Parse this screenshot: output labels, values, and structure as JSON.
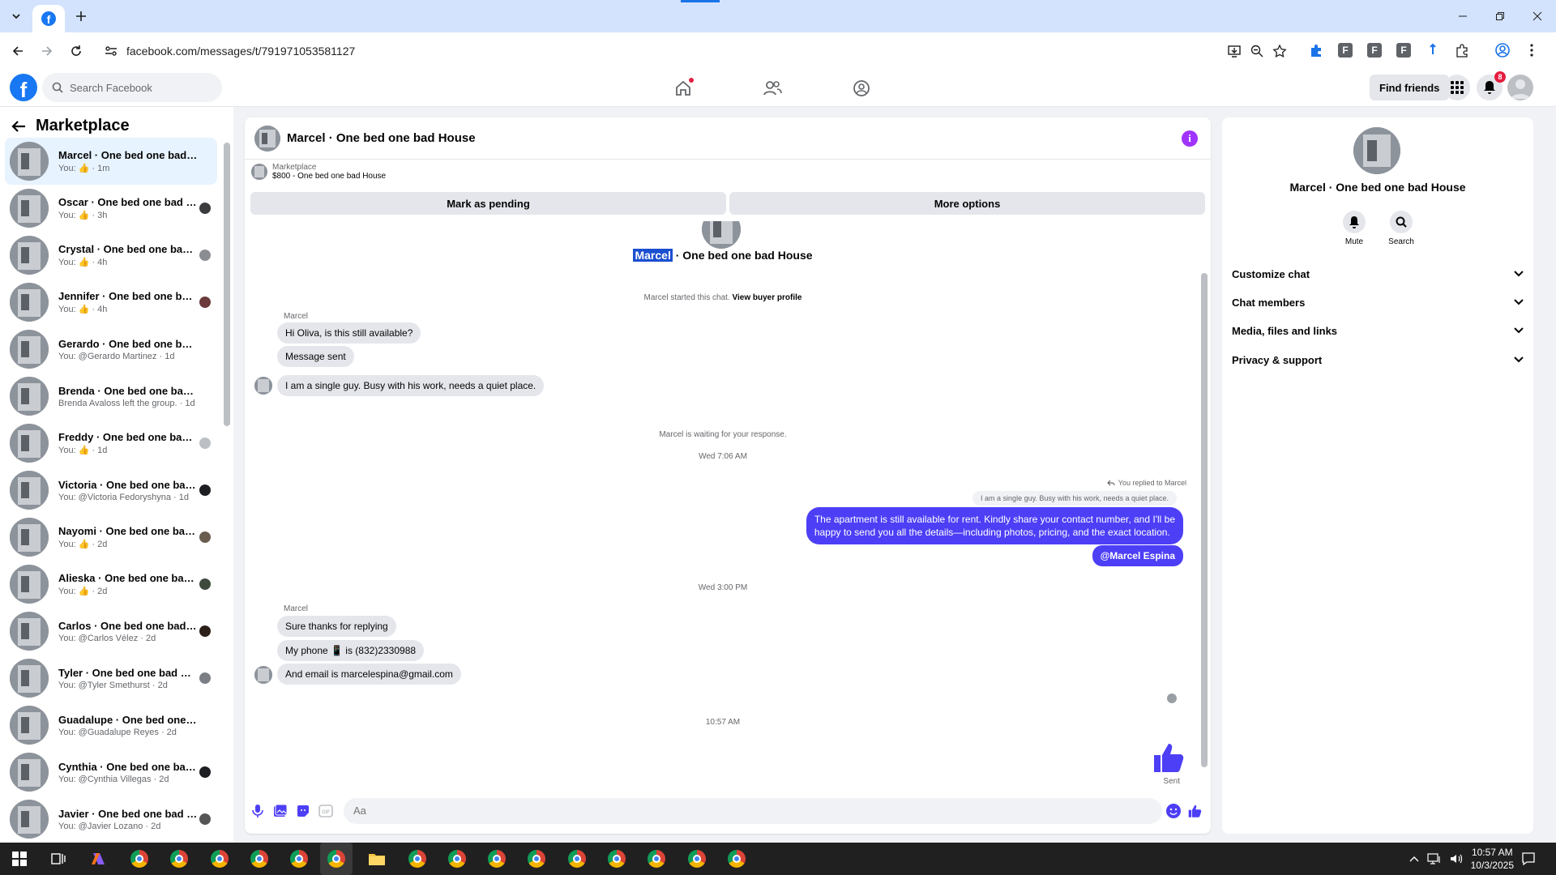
{
  "browser": {
    "url": "facebook.com/messages/t/791971053581127"
  },
  "fb_header": {
    "search_placeholder": "Search Facebook",
    "find_friends": "Find friends",
    "notifications_count": "8"
  },
  "left": {
    "title": "Marketplace",
    "conversations": [
      {
        "name": "Marcel · One bed one bad House",
        "sub": "You: 👍 · 1m"
      },
      {
        "name": "Oscar · One bed one bad Hou...",
        "sub": "You: 👍 · 3h"
      },
      {
        "name": "Crystal · One bed one bad Ho...",
        "sub": "You: 👍 · 4h"
      },
      {
        "name": "Jennifer · One bed one bad H...",
        "sub": "You: 👍 · 4h"
      },
      {
        "name": "Gerardo · One bed one bad Ho...",
        "sub": "You: @Gerardo Martinez · 1d"
      },
      {
        "name": "Brenda · One bed one bad House",
        "sub": "Brenda Avaloss left the group. · 1d"
      },
      {
        "name": "Freddy · One bed one bad Ho...",
        "sub": "You: 👍 · 1d"
      },
      {
        "name": "Victoria · One bed one bad H...",
        "sub": "You: @Victoria Fedoryshyna · 1d"
      },
      {
        "name": "Nayomi · One bed one bad H...",
        "sub": "You: 👍 · 2d"
      },
      {
        "name": "Alieska · One bed one bad H...",
        "sub": "You: 👍 · 2d"
      },
      {
        "name": "Carlos · One bed one bad Ho...",
        "sub": "You: @Carlos Vélez · 2d"
      },
      {
        "name": "Tyler · One bed one bad House",
        "sub": "You: @Tyler Smethurst · 2d"
      },
      {
        "name": "Guadalupe · One bed one bad ...",
        "sub": "You: @Guadalupe Reyes · 2d"
      },
      {
        "name": "Cynthia · One bed one bad H...",
        "sub": "You: @Cynthia Villegas · 2d"
      },
      {
        "name": "Javier · One bed one bad Ho...",
        "sub": "You: @Javier Lozano · 2d"
      }
    ]
  },
  "chat": {
    "title": "Marcel · One bed one bad House",
    "marketplace_label": "Marketplace",
    "listing": "$800 - One bed one bad House",
    "mark_pending": "Mark as pending",
    "more_options": "More options",
    "top_name_highlight": "Marcel",
    "top_name_rest": " · One bed one bad House",
    "started_text": "Marcel started this chat.",
    "view_profile": "View buyer profile",
    "sender1": "Marcel",
    "msg1": "Hi Oliva, is this still available?",
    "msg2": "Message sent",
    "msg3": "I am a single guy. Busy with his work, needs a quiet place.",
    "waiting": "Marcel is waiting for your response.",
    "ts1": "Wed 7:06 AM",
    "replied_to": "You replied to Marcel",
    "quote": "I am a single guy. Busy with his work, needs a quiet place.",
    "out_line1": "The apartment is still available for rent. Kindly share your contact number, and I'll be",
    "out_line2": "happy to send you all the details—including photos, pricing, and the exact location.",
    "mention": "@Marcel Espina",
    "ts2": "Wed 3:00 PM",
    "sender2": "Marcel",
    "msg4": "Sure thanks for replying",
    "msg5": "My phone 📱 is (832)2330988",
    "msg6": "And email is marcelespina@gmail.com",
    "ts3": "10:57 AM",
    "sent": "Sent",
    "composer_placeholder": "Aa"
  },
  "right": {
    "name": "Marcel · One bed one bad House",
    "mute": "Mute",
    "search": "Search",
    "rows": [
      "Customize chat",
      "Chat members",
      "Media, files and links",
      "Privacy & support"
    ]
  },
  "taskbar": {
    "time": "10:57 AM",
    "date": "10/3/2025"
  },
  "colors": {
    "fb_blue": "#1877f2",
    "outgoing_bubble": "#4d3ff6",
    "incoming_bubble": "#e4e6eb"
  }
}
